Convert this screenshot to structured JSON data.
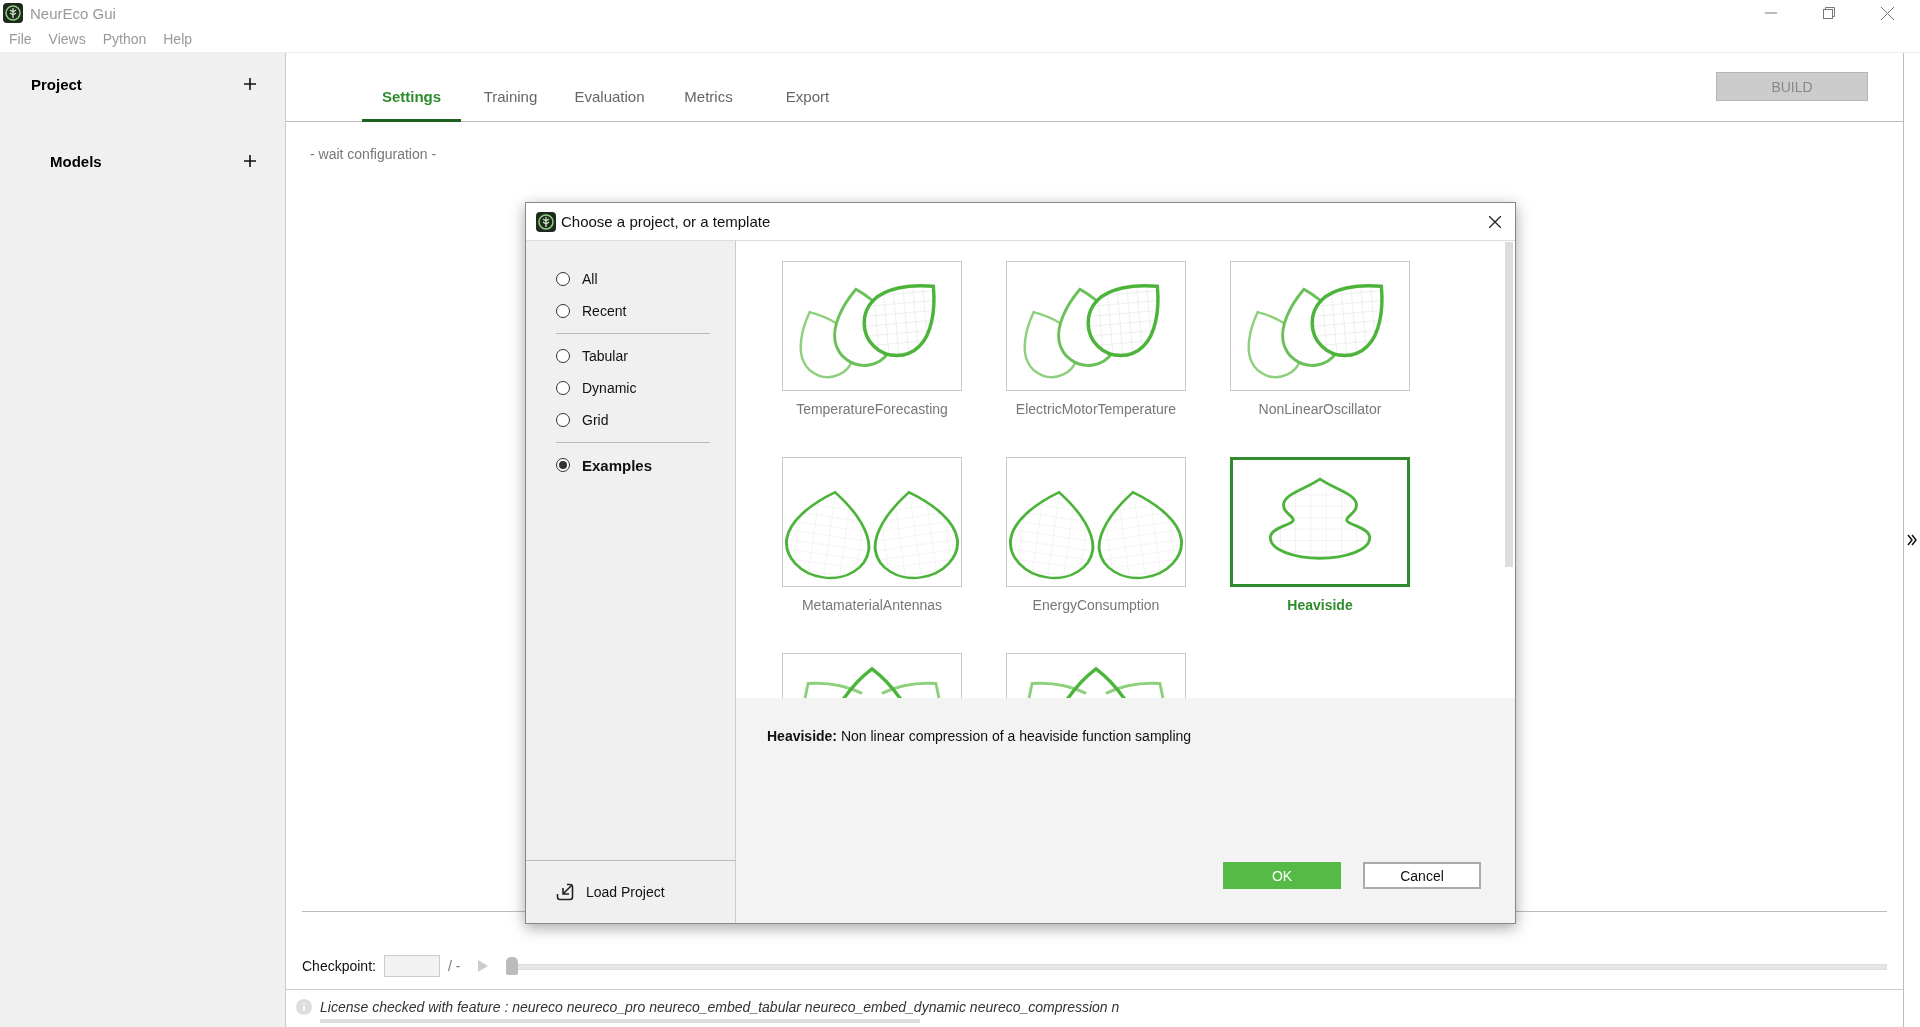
{
  "window": {
    "title": "NeurEco Gui"
  },
  "menu": [
    "File",
    "Views",
    "Python",
    "Help"
  ],
  "sidebar": {
    "sections": [
      {
        "label": "Project"
      },
      {
        "label": "Models"
      }
    ]
  },
  "tabs": [
    {
      "label": "Settings",
      "selected": true
    },
    {
      "label": "Training",
      "selected": false
    },
    {
      "label": "Evaluation",
      "selected": false
    },
    {
      "label": "Metrics",
      "selected": false
    },
    {
      "label": "Export",
      "selected": false
    }
  ],
  "build_button": {
    "label": "BUILD",
    "disabled": true
  },
  "status_message": "- wait configuration -",
  "checkpoint": {
    "label": "Checkpoint:",
    "total": "/ -",
    "level": 0
  },
  "status_bar": {
    "message": "License checked with feature : neureco neureco_pro neureco_embed_tabular neureco_embed_dynamic neureco_compression n"
  },
  "dialog": {
    "title": "Choose a project, or a template",
    "filter_groups": [
      [
        {
          "label": "All",
          "selected": false
        },
        {
          "label": "Recent",
          "selected": false
        }
      ],
      [
        {
          "label": "Tabular",
          "selected": false
        },
        {
          "label": "Dynamic",
          "selected": false
        },
        {
          "label": "Grid",
          "selected": false
        }
      ],
      [
        {
          "label": "Examples",
          "selected": true
        }
      ]
    ],
    "load_button": "Load Project",
    "templates": [
      {
        "label": "TemperatureForecasting",
        "kind": "three-leaves",
        "selected": false
      },
      {
        "label": "ElectricMotorTemperature",
        "kind": "three-leaves",
        "selected": false
      },
      {
        "label": "NonLinearOscillator",
        "kind": "three-leaves",
        "selected": false
      },
      {
        "label": "MetamaterialAntennas",
        "kind": "two-leaves",
        "selected": false
      },
      {
        "label": "EnergyConsumption",
        "kind": "two-leaves",
        "selected": false
      },
      {
        "label": "Heaviside",
        "kind": "bulb",
        "selected": true
      },
      {
        "kind": "lotus",
        "selected": false
      },
      {
        "kind": "lotus",
        "selected": false
      }
    ],
    "description": "**Heaviside:** Non linear compression of a heaviside function sampling",
    "buttons": [
      {
        "label": "OK",
        "kind": "primary"
      },
      {
        "label": "Cancel",
        "kind": "secondary"
      }
    ]
  }
}
